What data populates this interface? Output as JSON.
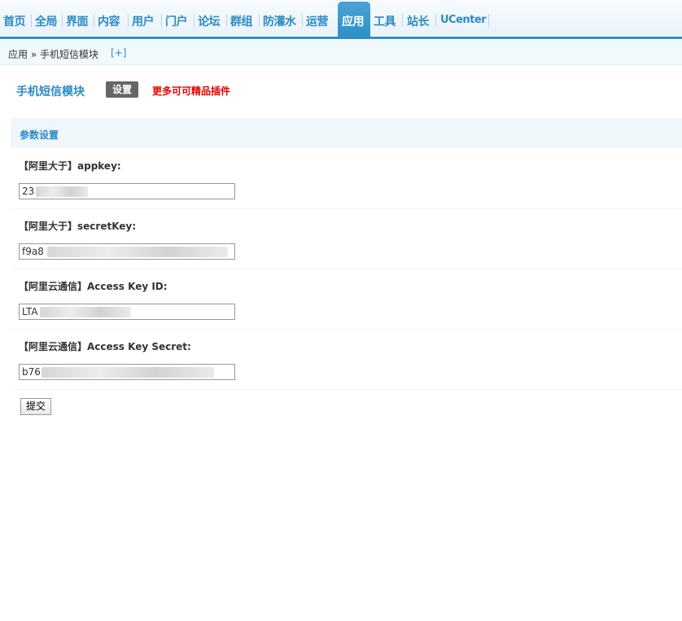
{
  "nav": {
    "items": [
      {
        "label": "首页"
      },
      {
        "label": "全局"
      },
      {
        "label": "界面"
      },
      {
        "label": "内容"
      },
      {
        "label": "用户"
      },
      {
        "label": "门户"
      },
      {
        "label": "论坛"
      },
      {
        "label": "群组"
      },
      {
        "label": "防灌水"
      },
      {
        "label": "运营"
      },
      {
        "label": "应用"
      },
      {
        "label": "工具"
      },
      {
        "label": "站长"
      },
      {
        "label": "UCenter"
      }
    ],
    "active": "应用"
  },
  "breadcrumb": {
    "path": "应用 » 手机短信模块",
    "add": "[+]"
  },
  "page": {
    "title": "手机短信模块",
    "settings_button": "设置",
    "more_link": "更多可可精品插件"
  },
  "section": {
    "title": "参数设置"
  },
  "fields": [
    {
      "label": "【阿里大于】appkey:",
      "value": "23"
    },
    {
      "label": "【阿里大于】secretKey:",
      "value": "f9a8"
    },
    {
      "label": "【阿里云通信】Access Key ID:",
      "value": "LTA"
    },
    {
      "label": "【阿里云通信】Access Key Secret:",
      "value": "b76"
    }
  ],
  "submit_label": "提交"
}
